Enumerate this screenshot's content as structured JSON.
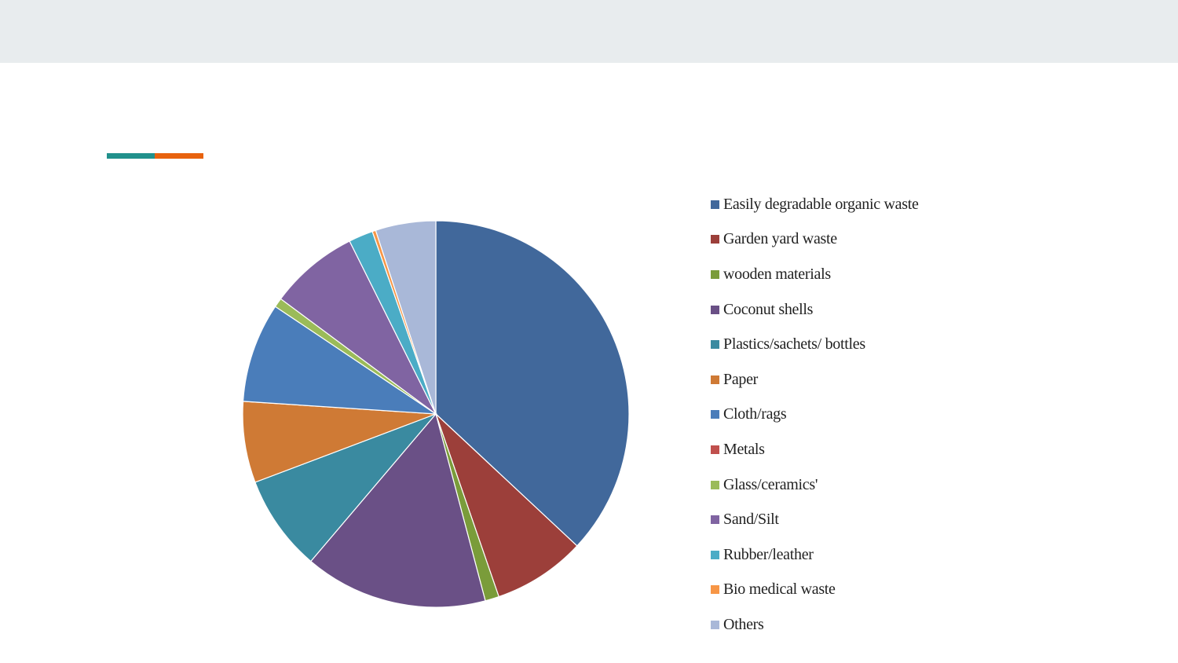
{
  "chart_data": {
    "type": "pie",
    "title": "",
    "legend_position": "right",
    "categories": [
      "Easily degradable organic waste",
      "Garden yard waste",
      "wooden materials",
      "Coconut shells",
      "Plastics/sachets/ bottles",
      "Paper",
      "Cloth/rags",
      "Metals",
      "Glass/ceramics'",
      "Sand/Silt",
      "Rubber/leather",
      "Bio medical waste",
      "Others"
    ],
    "values": [
      38.1,
      8.0,
      1.2,
      15.8,
      8.3,
      7.0,
      8.6,
      0.0,
      0.8,
      7.7,
      2.1,
      0.3,
      5.2
    ],
    "colors": [
      "#41689b",
      "#9c3f3a",
      "#7a9c3a",
      "#6a5086",
      "#3a8aa0",
      "#cf7a35",
      "#4a7dba",
      "#c0504d",
      "#9bbb59",
      "#8064a2",
      "#4bacc6",
      "#f79646",
      "#a9b8d8"
    ]
  },
  "accent": {
    "teal": "#21918c",
    "orange": "#e8620e"
  }
}
